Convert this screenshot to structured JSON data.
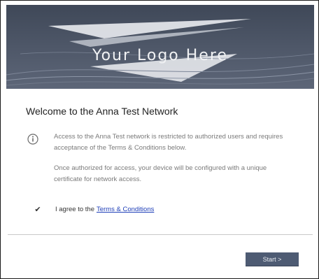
{
  "header": {
    "logo_text": "Your Logo Here"
  },
  "main": {
    "title": "Welcome to the Anna Test Network",
    "paragraph1": "Access to the Anna Test network is restricted to authorized users and requires acceptance of the Terms & Conditions below.",
    "paragraph2": "Once authorized for access, your device will be configured with a unique certificate for network access.",
    "agree_text": "I agree to the",
    "agree_link": "Terms & Conditions",
    "agree_checked": true,
    "start_button": "Start >"
  },
  "icons": {
    "info": "info-icon",
    "check": "check-icon"
  },
  "colors": {
    "header_bg": "#4c5668",
    "button_bg": "#4e5b73",
    "link": "#1f3fb8"
  }
}
